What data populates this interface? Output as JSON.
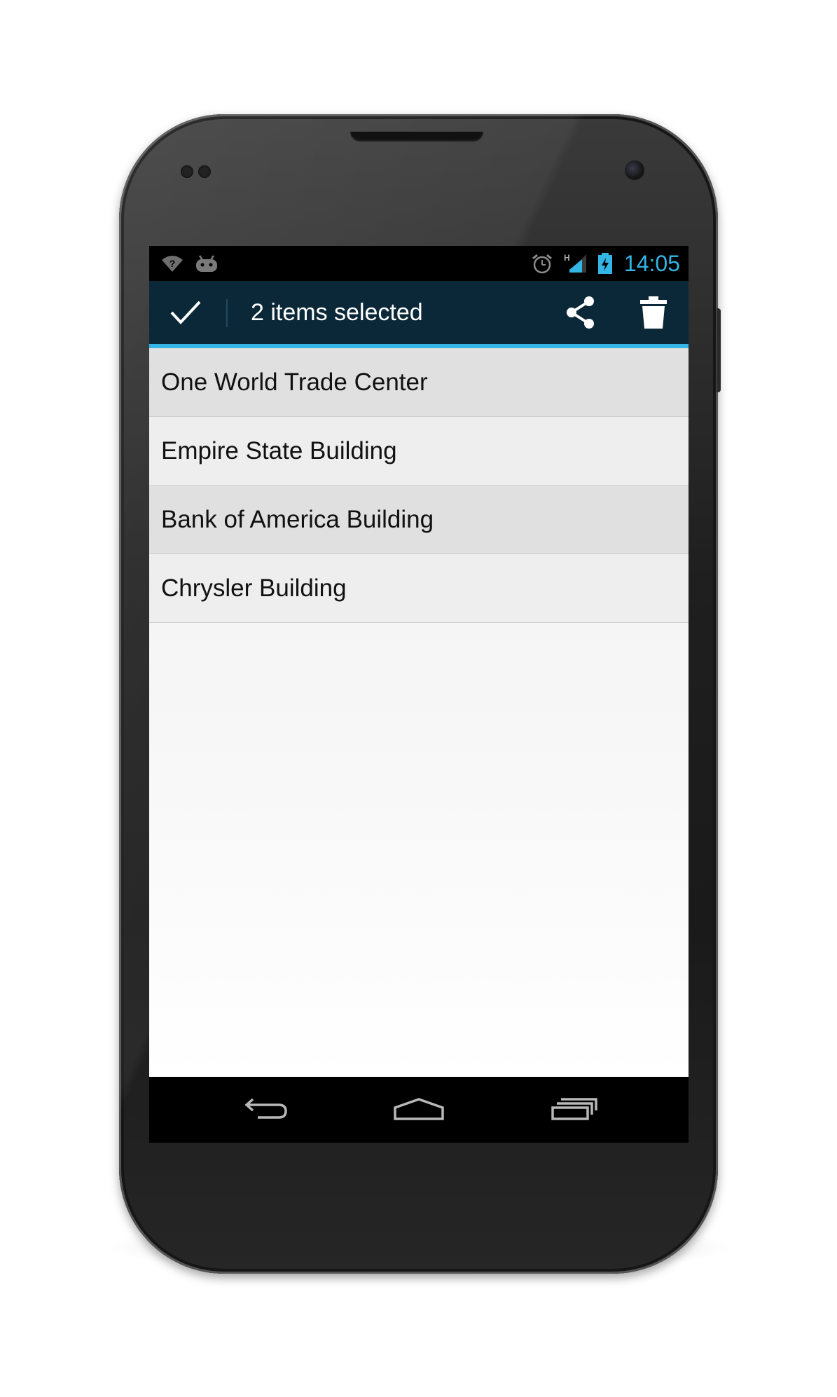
{
  "status_bar": {
    "time": "14:05",
    "network_type": "H",
    "icons": [
      "wifi-question-icon",
      "android-debug-icon",
      "alarm-icon",
      "signal-icon",
      "battery-charging-icon"
    ],
    "accent_color": "#33b5e5"
  },
  "action_mode": {
    "title": "2 items selected",
    "actions": [
      "check-icon",
      "share-icon",
      "trash-icon"
    ],
    "background_color": "#0b2838",
    "accent_color": "#33b5e5"
  },
  "list": {
    "items": [
      {
        "label": "One World Trade Center",
        "selected": true
      },
      {
        "label": "Empire State Building",
        "selected": false
      },
      {
        "label": "Bank of America Building",
        "selected": true
      },
      {
        "label": "Chrysler Building",
        "selected": false
      }
    ],
    "selected_color": "#e0e0e0"
  },
  "nav_bar": {
    "buttons": [
      "back-icon",
      "home-icon",
      "recent-apps-icon"
    ]
  }
}
